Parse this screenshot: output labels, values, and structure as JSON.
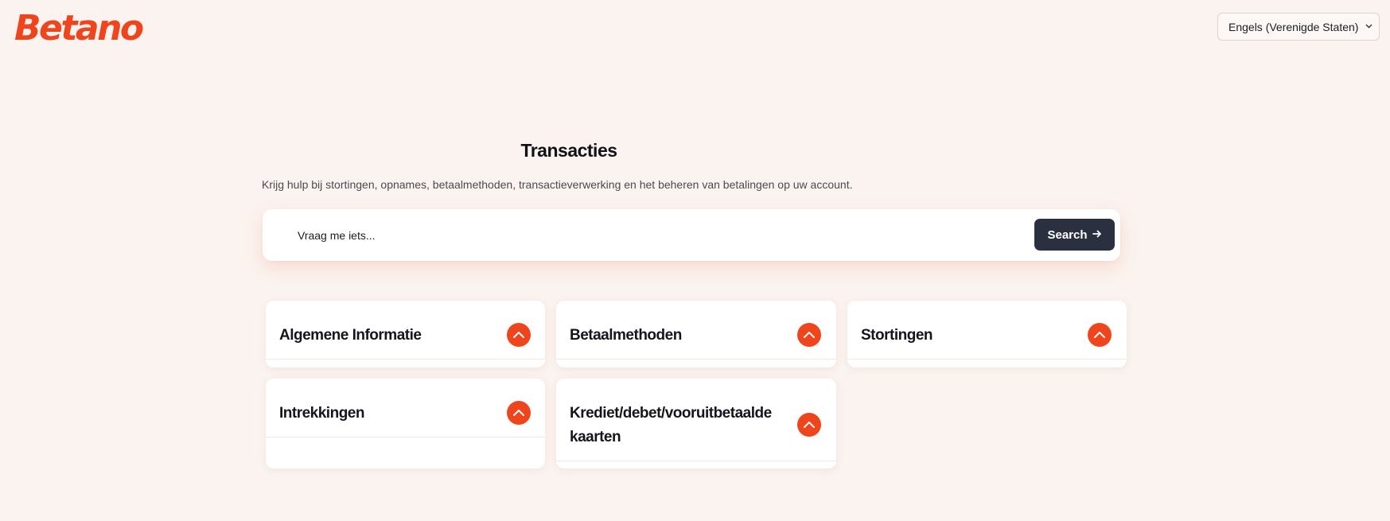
{
  "header": {
    "logo_text": "Betano",
    "language_selector": {
      "selected": "Engels (Verenigde Staten)",
      "icon": "chevron-down-icon"
    }
  },
  "main": {
    "title": "Transacties",
    "subtitle": "Krijg hulp bij stortingen, opnames, betaalmethoden, transactieverwerking en het beheren van betalingen op uw account.",
    "search": {
      "placeholder": "Vraag me iets...",
      "value": "",
      "button_label": "Search",
      "button_icon": "arrow-right-icon"
    },
    "categories": [
      {
        "label": "Algemene Informatie",
        "icon": "chevron-up-icon"
      },
      {
        "label": "Betaalmethoden",
        "icon": "chevron-up-icon"
      },
      {
        "label": "Stortingen",
        "icon": "chevron-up-icon"
      },
      {
        "label": "Intrekkingen",
        "icon": "chevron-up-icon"
      },
      {
        "label": "Krediet/debet/vooruitbetaalde kaarten",
        "icon": "chevron-up-icon"
      }
    ]
  },
  "colors": {
    "background": "#fbf3ef",
    "brand": "#f0441c",
    "button_dark": "#2a303d",
    "card": "#ffffff"
  }
}
